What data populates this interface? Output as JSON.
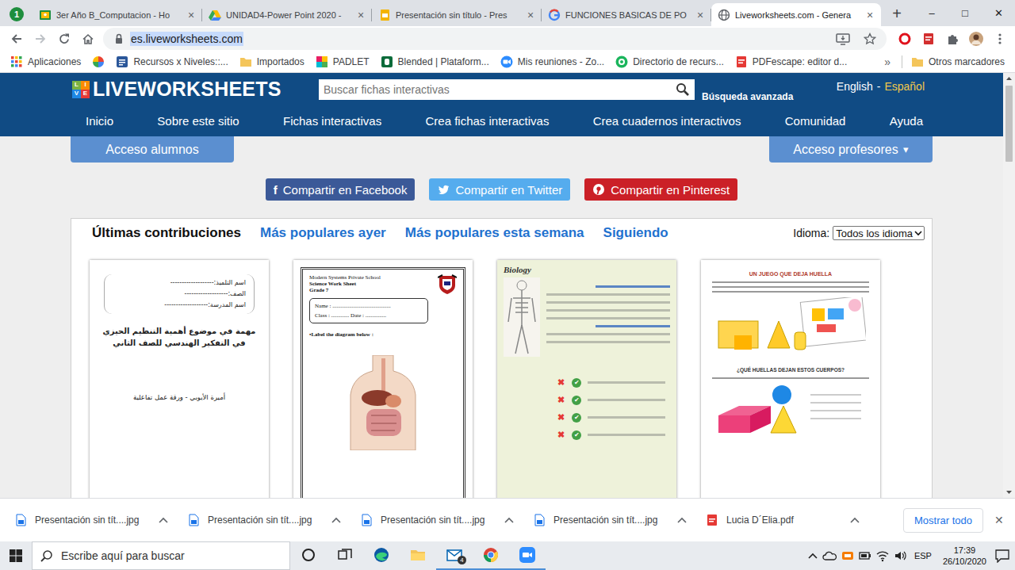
{
  "browser": {
    "badge": "1",
    "tabs": [
      {
        "label": "3er Año B_Computacion - Ho",
        "kind": "classroom",
        "selected": false
      },
      {
        "label": "UNIDAD4-Power Point 2020 -",
        "kind": "drive",
        "selected": false
      },
      {
        "label": "Presentación sin título - Pres",
        "kind": "slides",
        "selected": false
      },
      {
        "label": "FUNCIONES BASICAS DE PO",
        "kind": "google",
        "selected": false
      },
      {
        "label": "Liveworksheets.com - Genera",
        "kind": "globe",
        "selected": true
      }
    ],
    "tab_close": "×",
    "new_tab": "+",
    "window_controls": [
      "–",
      "□",
      "✕"
    ],
    "address": {
      "text": "es.liveworksheets.com",
      "selected": true
    },
    "bookmarks": [
      {
        "label": "Aplicaciones",
        "kind": "apps"
      },
      {
        "kind": "pinwheel"
      },
      {
        "label": "Recursos x Niveles::...",
        "kind": "word"
      },
      {
        "label": "Importados",
        "kind": "folder"
      },
      {
        "label": "PADLET",
        "kind": "padlet"
      },
      {
        "label": "Blended | Plataform...",
        "kind": "blended"
      },
      {
        "label": "Mis reuniones - Zo...",
        "kind": "zoom"
      },
      {
        "label": "Directorio de recurs...",
        "kind": "genially"
      },
      {
        "label": "PDFescape: editor d...",
        "kind": "pdf"
      }
    ],
    "bookmarks_more": "»",
    "other_bookmarks": "Otros marcadores"
  },
  "page": {
    "logo": {
      "badge": [
        "L",
        "I",
        "V",
        "E"
      ],
      "text": "LIVEWORKSHEETS"
    },
    "search": {
      "placeholder": "Buscar fichas interactivas",
      "advanced": "Búsqueda avanzada"
    },
    "languages": [
      {
        "label": "English",
        "selected": false
      },
      {
        "label": "Español",
        "selected": true
      }
    ],
    "language_separator": "-",
    "nav": [
      "Inicio",
      "Sobre este sitio",
      "Fichas interactivas",
      "Crea fichas interactivas",
      "Crea cuadernos interactivos",
      "Comunidad",
      "Ayuda"
    ],
    "access": {
      "students": "Acceso alumnos",
      "teachers": "Acceso profesores",
      "caret": "▾"
    },
    "share": [
      {
        "label": "Compartir en Facebook",
        "kind": "facebook",
        "glyph": "f",
        "color": "#3b5998"
      },
      {
        "label": "Compartir en Twitter",
        "kind": "twitter",
        "color": "#55acee"
      },
      {
        "label": "Compartir en Pinterest",
        "kind": "pinterest",
        "color": "#cb2027"
      }
    ],
    "tabs": [
      {
        "label": "Últimas contribuciones",
        "selected": true
      },
      {
        "label": "Más populares ayer",
        "selected": false
      },
      {
        "label": "Más populares esta semana",
        "selected": false
      },
      {
        "label": "Siguiendo",
        "selected": false
      }
    ],
    "language_filter": {
      "label": "Idioma:",
      "value": "Todos los idioma"
    },
    "cards": [
      {
        "kind": "arabic",
        "fields": [
          "اسم التلميذ:-------------------",
          "الصف:-------------------",
          "اسم المدرسة:-------------------"
        ],
        "title": "مهمة في موضوع أهمية التنظيم الحيزي في التفكير الهندسي للصف الثاني",
        "footer": "أميرة الأيوبي - ورقة عمل تفاعلية"
      },
      {
        "kind": "science",
        "school": "Modern Systems Private School",
        "subject": "Science Work Sheet",
        "grade": "Grade 7",
        "name_field": "Name : ..........................................",
        "class_field": "Class : ............. Date : ...............",
        "instruction": "•Label the diagram below :"
      },
      {
        "kind": "biology",
        "title": "Biology",
        "rows": [
          {
            "wrong": "✖",
            "right": "✔"
          },
          {
            "wrong": "✖",
            "right": "✔"
          },
          {
            "wrong": "✖",
            "right": "✔"
          },
          {
            "wrong": "✖",
            "right": "✔"
          }
        ]
      },
      {
        "kind": "game",
        "title": "UN JUEGO QUE DEJA HUELLA",
        "question": "¿QUÉ HUELLAS DEJAN ESTOS CUERPOS?"
      }
    ]
  },
  "downloads": {
    "items": [
      {
        "name": "Presentación sin tít....jpg",
        "kind": "image"
      },
      {
        "name": "Presentación sin tít....jpg",
        "kind": "image"
      },
      {
        "name": "Presentación sin tít....jpg",
        "kind": "image"
      },
      {
        "name": "Presentación sin tít....jpg",
        "kind": "image"
      },
      {
        "name": "Lucia D´Elia.pdf",
        "kind": "pdf"
      }
    ],
    "show_all": "Mostrar todo",
    "close": "✕"
  },
  "taskbar": {
    "search": "Escribe aquí para buscar",
    "apps": [
      {
        "kind": "cortana",
        "open": false
      },
      {
        "kind": "taskview",
        "open": false
      },
      {
        "kind": "edge",
        "open": false
      },
      {
        "kind": "explorer",
        "open": false
      },
      {
        "kind": "mail",
        "open": true,
        "badge": "4"
      },
      {
        "kind": "chrome",
        "open": true
      },
      {
        "kind": "zoom",
        "open": true
      }
    ],
    "language": "ESP",
    "time": "17:39",
    "date": "26/10/2020"
  }
}
